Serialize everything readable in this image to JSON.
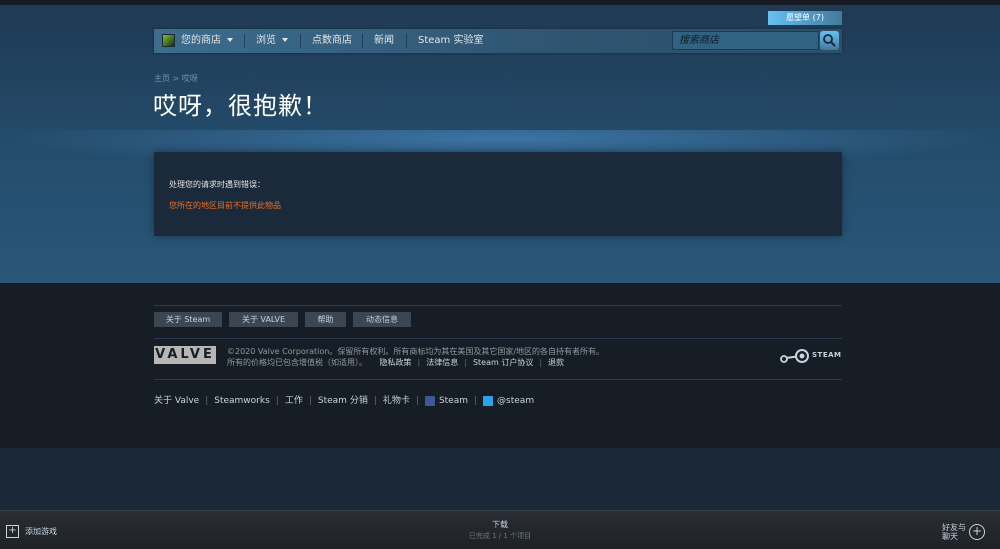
{
  "wishlist": {
    "label": "愿望单 (7)"
  },
  "nav": {
    "your_store": "您的商店",
    "browse": "浏览",
    "points_store": "点数商店",
    "news": "新闻",
    "labs": "Steam 实验室"
  },
  "search": {
    "placeholder": "搜索商店"
  },
  "breadcrumb": {
    "home": "主页",
    "separator": ">",
    "current": "哎呀"
  },
  "title": "哎呀，很抱歉！",
  "error": {
    "heading": "处理您的请求时遇到错误：",
    "message": "您所在的地区目前不提供此物品"
  },
  "footer": {
    "buttons": [
      "关于 Steam",
      "关于 VALVE",
      "帮助",
      "动态信息"
    ],
    "valve_logo": "VALVE",
    "copyright_line1": "©2020 Valve Corporation。保留所有权利。所有商标均为其在美国及其它国家/地区的各自持有者所有。",
    "copyright_line2": "所有的价格均已包含增值税（如适用）。",
    "policy_links": [
      "隐私政策",
      "法律信息",
      "Steam 订户协议",
      "退款"
    ],
    "steam_logo_text": "STEAM",
    "links": [
      "关于 Valve",
      "Steamworks",
      "工作",
      "Steam 分销",
      "礼物卡"
    ],
    "facebook": "Steam",
    "twitter": "@steam"
  },
  "bottom_bar": {
    "add_game": "添加游戏",
    "downloads_label": "下载",
    "downloads_status": "已完成 1 / 1 个项目",
    "friends_line1": "好友与",
    "friends_line2": "聊天"
  },
  "colors": {
    "accent_blue": "#67c1f5",
    "error_orange": "#e87026",
    "page_bg": "#1b2838"
  }
}
